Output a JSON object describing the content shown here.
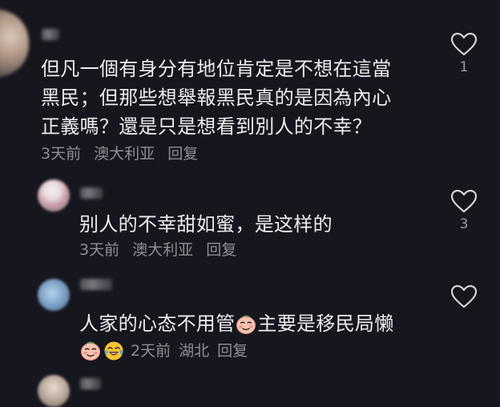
{
  "comments": [
    {
      "text_lines": [
        "但凡一個有身分有地位肯定是不想在這當",
        "黑民；但那些想舉報黑民真的是因為內心",
        "正義嗎？還是只是想看到別人的不幸？"
      ],
      "time": "3天前",
      "location": "澳大利亚",
      "reply_label": "回复",
      "likes": "1"
    },
    {
      "text": "别人的不幸甜如蜜，是这样的",
      "time": "3天前",
      "location": "澳大利亚",
      "reply_label": "回复",
      "likes": "3"
    },
    {
      "text_before_emoji": "人家的心态不用管",
      "text_after_emoji": "主要是移民局懒",
      "time": "2天前",
      "location": "湖北",
      "reply_label": "回复",
      "likes": ""
    }
  ],
  "icons": {
    "like": "heart-outline-icon",
    "emoji_a": "smirk-face-emoji",
    "emoji_b": "laughing-tears-emoji"
  },
  "colors": {
    "background": "#16161e",
    "text": "#ececef",
    "meta": "#8e8e96"
  }
}
